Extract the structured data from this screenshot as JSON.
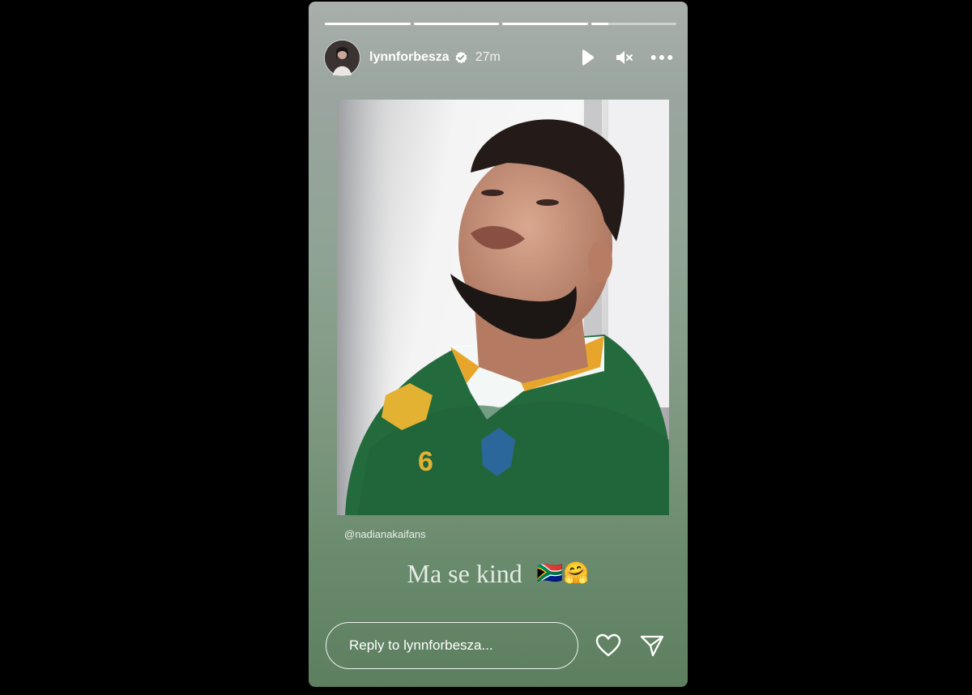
{
  "story": {
    "progress": [
      1,
      1,
      1,
      0.2
    ],
    "user": {
      "username": "lynnforbesza",
      "verified": true,
      "time_ago": "27m"
    },
    "photo": {
      "jersey_number": "6"
    },
    "mention": "@nadianakaifans",
    "caption": {
      "text": "Ma se kind",
      "emoji": "🇿🇦🤗"
    },
    "reply": {
      "placeholder": "Reply to lynnforbesza..."
    },
    "icons": {
      "play": "play-icon",
      "mute": "muted-speaker-icon",
      "more": "more-options-icon",
      "like": "heart-icon",
      "share": "send-icon"
    }
  }
}
